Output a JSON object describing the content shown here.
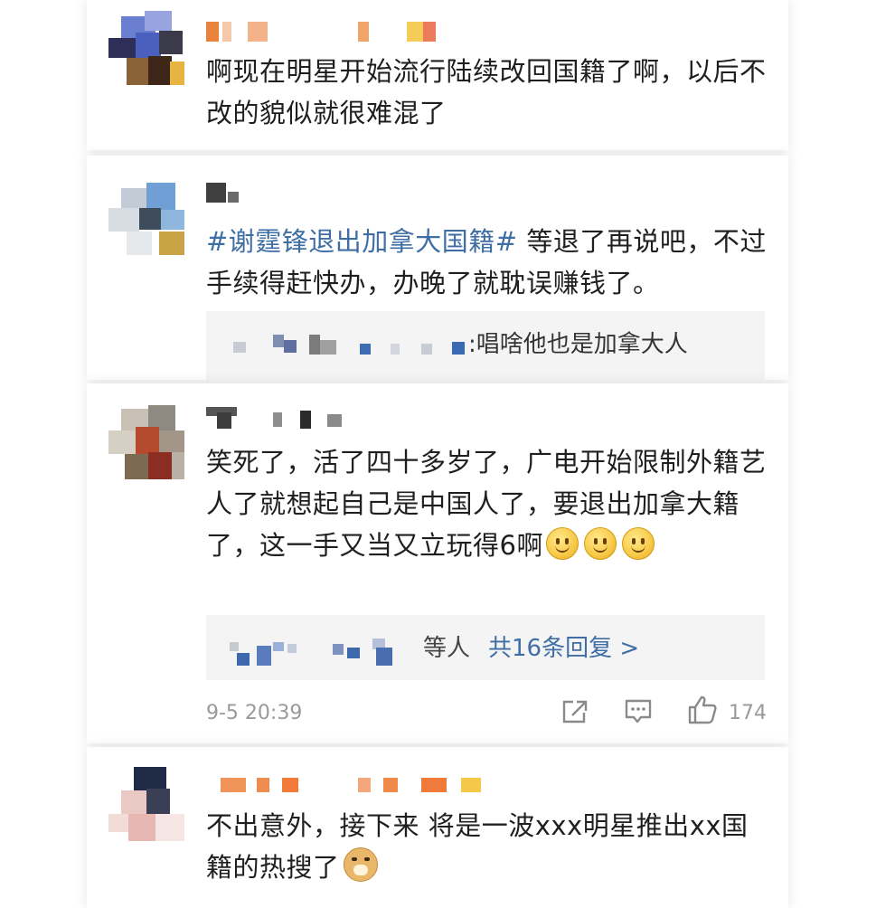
{
  "comments": [
    {
      "text": "啊现在明星开始流行陆续改回国籍了啊，以后不改的貌似就很难混了"
    },
    {
      "topic": "#谢霆锋退出加拿大国籍#",
      "text": " 等退了再说吧，不过手续得赶快办，办晚了就耽误赚钱了。",
      "reply": {
        "text": ":唱啥他也是加拿大人"
      }
    },
    {
      "text": "笑死了，活了四十多岁了，广电开始限制外籍艺人了就想起自己是中国人了，要退出加拿大籍了，这一手又当又立玩得6啊",
      "emojis": [
        "smile-emoji",
        "smile-emoji",
        "smile-emoji"
      ],
      "replies_summary": {
        "suffix": "等人",
        "link": "共16条回复 >"
      },
      "timestamp": "9-5 20:39",
      "likes": "174"
    },
    {
      "text": "不出意外，接下来 将是一波xxx明星推出xx国籍的热搜了",
      "emoji": "doge-emoji"
    }
  ],
  "colors": {
    "topic": "#3f6ea5",
    "text": "#1f1f1f",
    "meta": "#9a9a9a",
    "reply_bg": "#f4f4f4"
  },
  "icons": [
    "share-icon",
    "comment-icon",
    "like-icon"
  ]
}
